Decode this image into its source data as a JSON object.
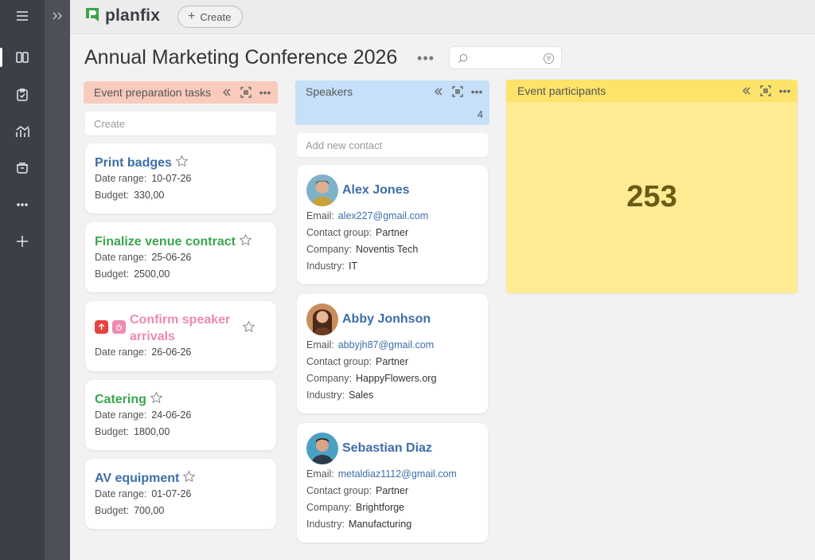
{
  "app": {
    "logo_text": "planfix",
    "create_label": "Create"
  },
  "page": {
    "title": "Annual Marketing Conference 2026",
    "search_placeholder": ""
  },
  "nav": {
    "items": [
      "board-icon",
      "tasks-icon",
      "analytics-icon",
      "archive-icon",
      "more-icon",
      "add-icon"
    ]
  },
  "columns": {
    "tasks": {
      "title": "Event preparation tasks",
      "color": "#f9cbbd",
      "create_placeholder": "Create",
      "cards": [
        {
          "title": "Print badges",
          "title_color": "#3d6ea8",
          "date_label": "Date range:",
          "date": "10-07-26",
          "budget_label": "Budget:",
          "budget": "330,00"
        },
        {
          "title": "Finalize venue contract",
          "title_color": "#3aa54e",
          "date_label": "Date range:",
          "date": "25-06-26",
          "budget_label": "Budget:",
          "budget": "2500,00"
        },
        {
          "title_line1": "Confirm speaker",
          "title_line2": "arrivals",
          "title_color": "#ef8ab0",
          "date_label": "Date range:",
          "date": "26-06-26"
        },
        {
          "title": "Catering",
          "title_color": "#3aa54e",
          "date_label": "Date range:",
          "date": "24-06-26",
          "budget_label": "Budget:",
          "budget": "1800,00"
        },
        {
          "title": "AV equipment",
          "title_color": "#3d6ea8",
          "date_label": "Date range:",
          "date": "01-07-26",
          "budget_label": "Budget:",
          "budget": "700,00"
        }
      ]
    },
    "speakers": {
      "title": "Speakers",
      "color": "#c5e0f8",
      "count": "4",
      "add_placeholder": "Add new contact",
      "contacts": [
        {
          "name": "Alex Jones",
          "email_label": "Email:",
          "email": "alex227@gmail.com",
          "group_label": "Contact group:",
          "group": "Partner",
          "company_label": "Company:",
          "company": "Noventis Tech",
          "industry_label": "Industry:",
          "industry": "IT"
        },
        {
          "name": "Abby Jonhson",
          "email_label": "Email:",
          "email": "abbyjh87@gmail.com",
          "group_label": "Contact group:",
          "group": "Partner",
          "company_label": "Company:",
          "company": "HappyFlowers.org",
          "industry_label": "Industry:",
          "industry": "Sales"
        },
        {
          "name": "Sebastian Diaz",
          "email_label": "Email:",
          "email": "metaldiaz1112@gmail.com",
          "group_label": "Contact group:",
          "group": "Partner",
          "company_label": "Company:",
          "company": "Brightforge",
          "industry_label": "Industry:",
          "industry": "Manufacturing"
        }
      ]
    },
    "participants": {
      "title": "Event participants",
      "color": "#ffeb94",
      "count": "253"
    }
  }
}
